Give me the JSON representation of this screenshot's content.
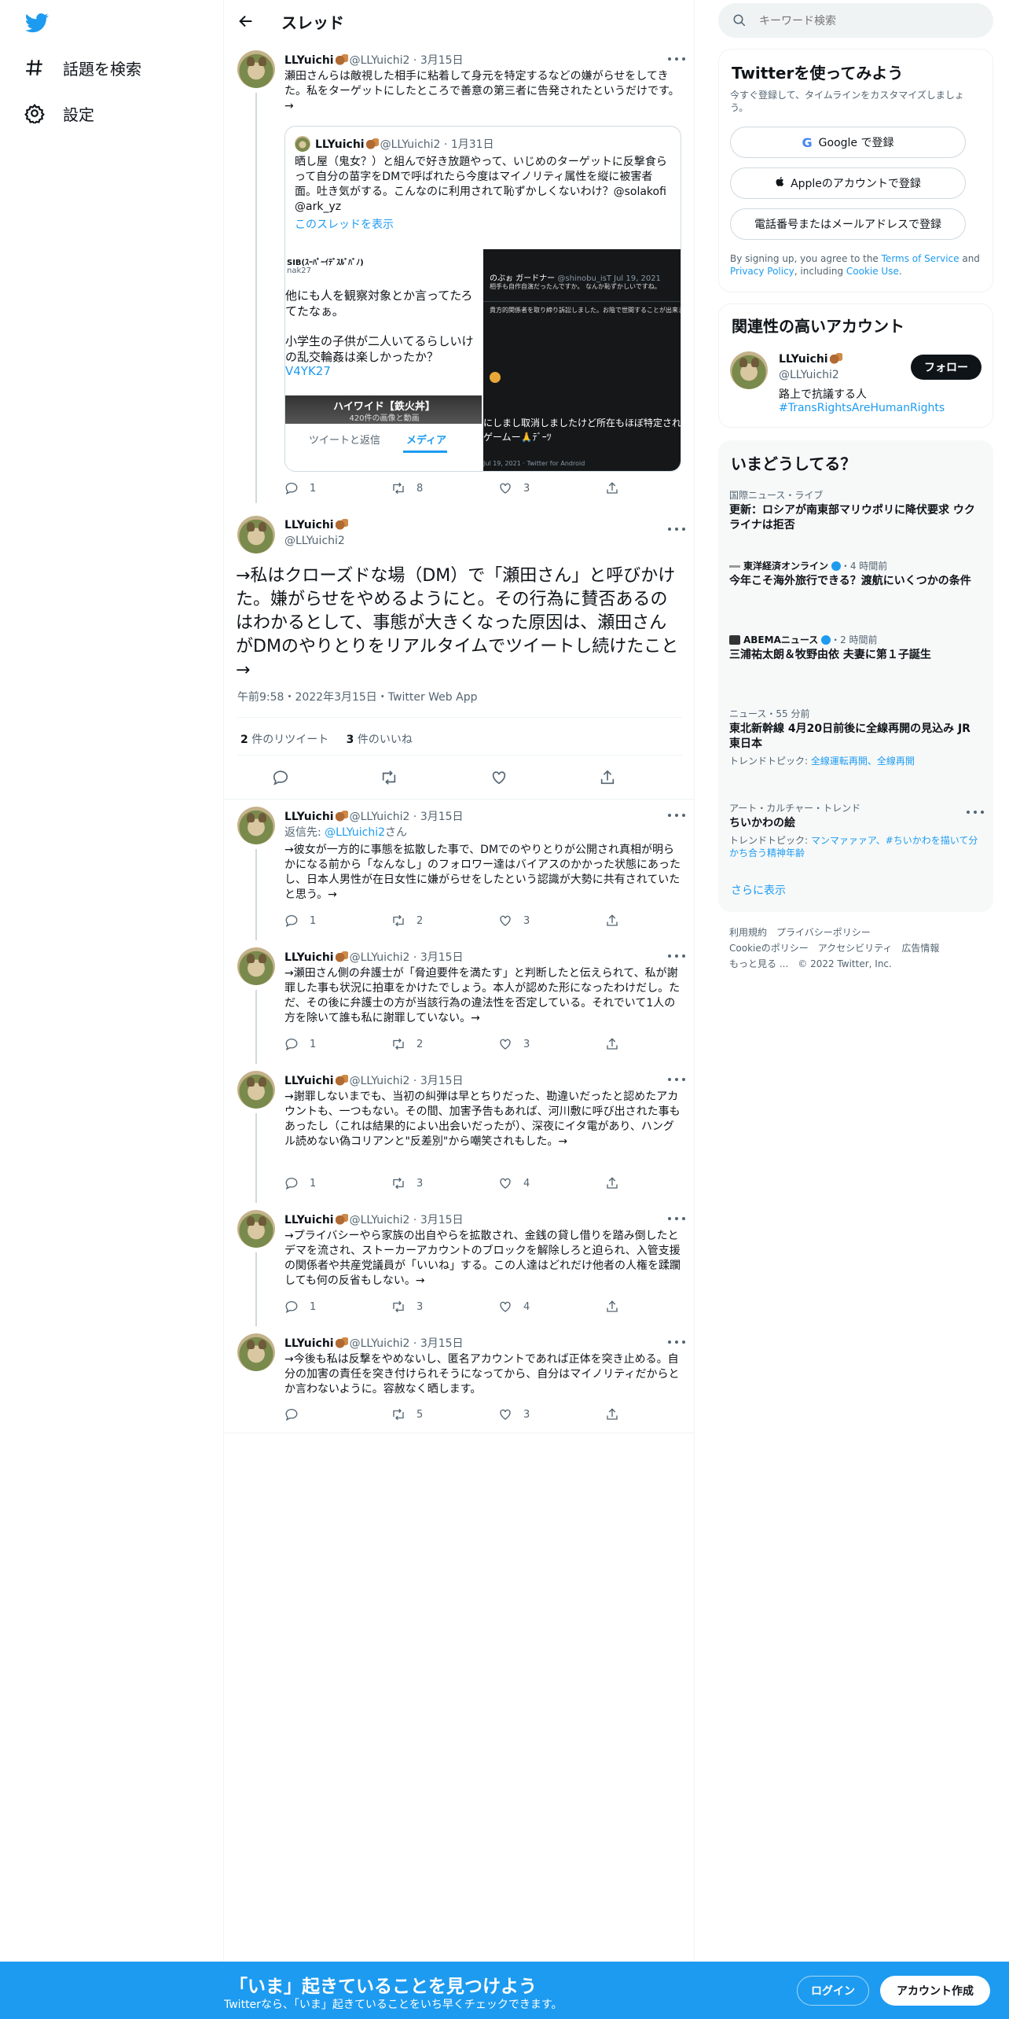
{
  "nav": {
    "explore_label": "話題を検索",
    "settings_label": "設定"
  },
  "header": {
    "title": "スレッド"
  },
  "tweet1": {
    "name": "LLYuichi",
    "handle": "@LLYuichi2",
    "date": "3月15日",
    "text": "瀬田さんらは敵視した相手に粘着して身元を特定するなどの嫌がらせをしてきた。私をターゲットにしたところで善意の第三者に告発されたというだけです。→",
    "quote": {
      "name": "LLYuichi",
      "handle": "@LLYuichi2",
      "date": "1月31日",
      "text": "晒し屋（鬼女？）と組んで好き放題やって、いじめのターゲットに反撃食らって自分の苗字をDMで呼ばれたら今度はマイノリティ属性を縦に被害者面。吐き気がする。こんなのに利用されて恥ずかしくないわけ？@solakofi @ark_yz",
      "show_thread": "このスレッドを表示",
      "left_img": {
        "user": "SIB(ｽｰﾊﾟｰｲﾃﾞｽﾙﾞﾊﾞﾉ)",
        "handle": "nak27",
        "line1": "他にも人を観察対象とか言ってたろ",
        "line2": "てたなぁ。",
        "line3": "小学生の子供が二人いてるらしいけ",
        "line4": "の乱交輪姦は楽しかったか？",
        "link": "V4YK27",
        "banner_title": "ハイワイド【鉄火丼】",
        "banner_sub": "420件の画像と動画",
        "tab1": "ツイートと返信",
        "tab2": "メディア"
      },
      "right_img": {
        "name": "のぶぉ ガードナー",
        "handle": "@shinobu_isT",
        "date": "Jul 19, 2021",
        "line1": "相手も自作自演だったんですか。 なんか恥ずかしいですね。",
        "line2": "貴方的関係者を取り締り訴訟しました。お陰で世間することが出来ました",
        "line3": "にしまし取消しましたけど所在もほぼ特定されてし",
        "line4": "ゲームー🙏ﾃﾞｰﾂ",
        "footer": "Jul 19, 2021 · Twitter for Android"
      }
    },
    "replies": "1",
    "retweets": "8",
    "likes": "3"
  },
  "main_tweet": {
    "name": "LLYuichi",
    "handle": "@LLYuichi2",
    "text": "→私はクローズドな場（DM）で「瀬田さん」と呼びかけた。嫌がらせをやめるようにと。その行為に賛否あるのはわかるとして、事態が大きくなった原因は、瀬田さんがDMのやりとりをリアルタイムでツイートし続けたこと→",
    "meta": "午前9:58・2022年3月15日・Twitter Web App",
    "retweet_count": "2",
    "retweet_label": "件のリツイート",
    "like_count": "3",
    "like_label": "件のいいね"
  },
  "replies": [
    {
      "name": "LLYuichi",
      "handle": "@LLYuichi2",
      "date": "3月15日",
      "reply_to_prefix": "返信先: ",
      "reply_to_handle": "@LLYuichi2",
      "reply_to_suffix": "さん",
      "text": "→彼女が一方的に事態を拡散した事で、DMでのやりとりが公開され真相が明らかになる前から「なんなし」のフォロワー達はバイアスのかかった状態にあったし、日本人男性が在日女性に嫌がらせをしたという認識が大勢に共有されていたと思う。→",
      "replies": "1",
      "retweets": "2",
      "likes": "3"
    },
    {
      "name": "LLYuichi",
      "handle": "@LLYuichi2",
      "date": "3月15日",
      "text": "→瀬田さん側の弁護士が「脅迫要件を満たす」と判断したと伝えられて、私が謝罪した事も状況に拍車をかけたでしょう。本人が認めた形になったわけだし。ただ、その後に弁護士の方が当該行為の違法性を否定している。それでいて1人の方を除いて誰も私に謝罪していない。→",
      "replies": "1",
      "retweets": "2",
      "likes": "3"
    },
    {
      "name": "LLYuichi",
      "handle": "@LLYuichi2",
      "date": "3月15日",
      "text": "→謝罪しないまでも、当初の糾弾は早とちりだった、勘違いだったと認めたアカウントも、一つもない。その間、加害予告もあれば、河川敷に呼び出された事もあったし（これは結果的によい出会いだったが）、深夜にイタ電があり、ハングル読めない偽コリアンと\"反差別\"から嘲笑されもした。→",
      "replies": "1",
      "retweets": "3",
      "likes": "4"
    },
    {
      "name": "LLYuichi",
      "handle": "@LLYuichi2",
      "date": "3月15日",
      "text": "→プライバシーやら家族の出自やらを拡散され、金銭の貸し借りを踏み倒したとデマを流され、ストーカーアカウントのブロックを解除しろと迫られ、入管支援の関係者や共産党議員が「いいね」する。この人達はどれだけ他者の人権を蹂躙しても何の反省もしない。→",
      "replies": "1",
      "retweets": "3",
      "likes": "4"
    },
    {
      "name": "LLYuichi",
      "handle": "@LLYuichi2",
      "date": "3月15日",
      "text": "→今後も私は反撃をやめないし、匿名アカウントであれば正体を突き止める。自分の加害の責任を突き付けられそうになってから、自分はマイノリティだからとか言わないように。容赦なく晒します。",
      "replies": "",
      "retweets": "5",
      "likes": "3"
    }
  ],
  "search": {
    "placeholder": "キーワード検索"
  },
  "signup": {
    "title": "Twitterを使ってみよう",
    "sub": "今すぐ登録して、タイムラインをカスタマイズしましょう。",
    "google": "Google で登録",
    "apple": "Appleのアカウントで登録",
    "phone": "電話番号またはメールアドレスで登録",
    "tos_1": "By signing up, you agree to the ",
    "tos_link": "Terms of Service",
    "tos_2": " and ",
    "privacy_link": "Privacy Policy",
    "tos_3": ", including ",
    "cookie_link": "Cookie Use",
    "tos_4": "."
  },
  "related": {
    "title": "関連性の高いアカウント",
    "name": "LLYuichi",
    "handle": "@LLYuichi2",
    "follow": "フォロー",
    "bio": "路上で抗議する人",
    "bio_tag": "#TransRightsAreHumanRights"
  },
  "trends": {
    "title": "いまどうしてる？",
    "items": [
      {
        "meta": "国際ニュース・ライブ",
        "head": "更新：ロシアが南東部マリウポリに降伏要求 ウクライナは拒否"
      },
      {
        "source": "東洋経済オンライン",
        "time": "・4 時間前",
        "head": "今年こそ海外旅行できる？渡航にいくつかの条件"
      },
      {
        "source": "ABEMAニュース",
        "time": "・2 時間前",
        "head": "三浦祐太朗＆牧野由依 夫妻に第１子誕生"
      },
      {
        "meta": "ニュース・55 分前",
        "head": "東北新幹線 4月20日前後に全線再開の見込み JR東日本",
        "sub_prefix": "トレンドトピック: ",
        "sub_links": "全線運転再開、全線再開"
      },
      {
        "meta": "アート・カルチャー・トレンド",
        "head": "ちいかわの絵",
        "sub_prefix": "トレンドトピック: ",
        "sub_links": "マンマァァァア、#ちいかわを描いて分かち合う精神年齢"
      }
    ],
    "show_more": "さらに表示"
  },
  "footer": {
    "line1": "利用規約　プライバシーポリシー",
    "line2": "Cookieのポリシー　アクセシビリティ　広告情報",
    "line3": "もっと見る ...　© 2022 Twitter, Inc."
  },
  "bottom": {
    "title": "「いま」起きていることを見つけよう",
    "sub": "Twitterなら、「いま」起きていることをいち早くチェックできます。",
    "login": "ログイン",
    "signup": "アカウント作成"
  },
  "colors": {
    "accent": "#1d9bf0",
    "text": "#0f1419",
    "muted": "#536471"
  }
}
